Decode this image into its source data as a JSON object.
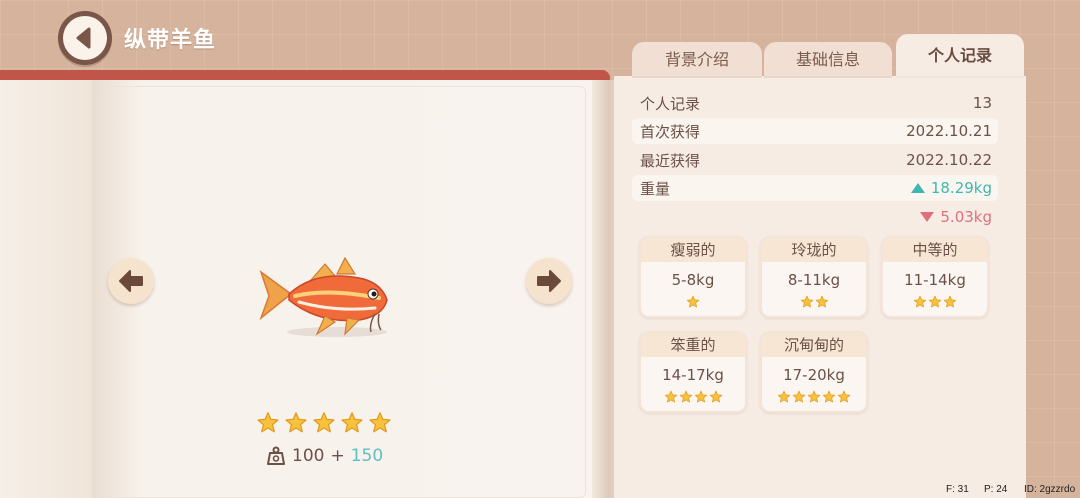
{
  "header": {
    "title": "纵带羊鱼"
  },
  "tabs": [
    {
      "label": "背景介绍",
      "active": false
    },
    {
      "label": "基础信息",
      "active": false
    },
    {
      "label": "个人记录",
      "active": true
    }
  ],
  "fish": {
    "rarity_stars": 5,
    "weight_base": "100",
    "weight_plus": "+",
    "weight_bonus": "150"
  },
  "records": {
    "count_label": "个人记录",
    "count_value": "13",
    "first_label": "首次获得",
    "first_value": "2022.10.21",
    "recent_label": "最近获得",
    "recent_value": "2022.10.22",
    "weight_label": "重量",
    "weight_max": "18.29kg",
    "weight_min": "5.03kg"
  },
  "grades": [
    {
      "name": "瘦弱的",
      "range": "5-8kg",
      "stars": 1
    },
    {
      "name": "玲珑的",
      "range": "8-11kg",
      "stars": 2
    },
    {
      "name": "中等的",
      "range": "11-14kg",
      "stars": 3
    },
    {
      "name": "笨重的",
      "range": "14-17kg",
      "stars": 4
    },
    {
      "name": "沉甸甸的",
      "range": "17-20kg",
      "stars": 5
    }
  ],
  "debug": {
    "f": "F: 31",
    "p": "P: 24",
    "id": "ID: 2gzzrdo"
  },
  "colors": {
    "accent_up": "#3fb6b2",
    "accent_down": "#e0707c",
    "bonus": "#5dbfc0",
    "spine": "#c2554a"
  }
}
